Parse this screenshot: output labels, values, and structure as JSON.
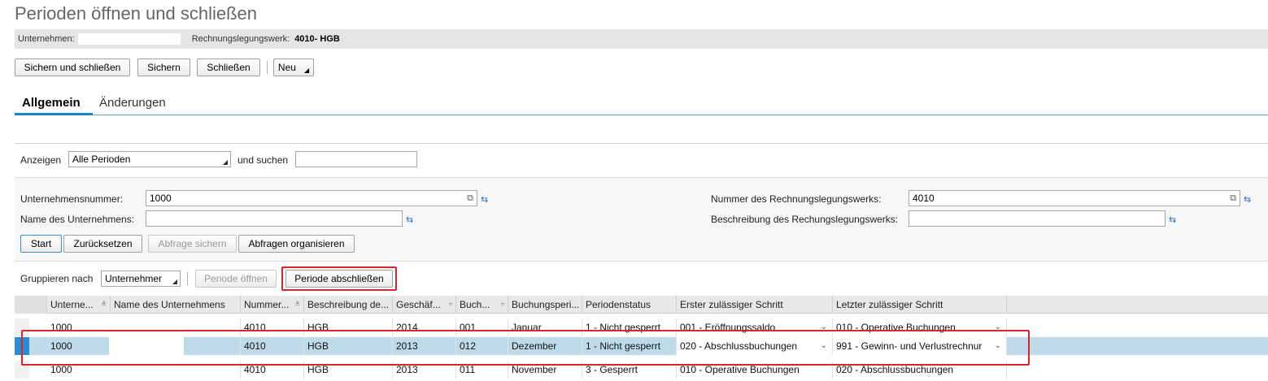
{
  "title": "Perioden öffnen und schließen",
  "header": {
    "company_label": "Unternehmen:",
    "company_value": "",
    "ledger_label": "Rechnungslegungswerk:",
    "ledger_value": "4010- HGB"
  },
  "toolbar": {
    "save_close": "Sichern und schließen",
    "save": "Sichern",
    "close": "Schließen",
    "new": "Neu"
  },
  "tabs": {
    "general": "Allgemein",
    "changes": "Änderungen"
  },
  "show_bar": {
    "show_label": "Anzeigen",
    "show_value": "Alle Perioden",
    "search_label": "und suchen",
    "search_value": ""
  },
  "filter": {
    "company_number_label": "Unternehmensnummer:",
    "company_number_value": "1000",
    "company_name_label": "Name des Unternehmens:",
    "company_name_value": "",
    "ledger_number_label": "Nummer des Rechnungslegungswerks:",
    "ledger_number_value": "4010",
    "ledger_desc_label": "Beschreibung des Rechungslegungswerks:",
    "ledger_desc_value": "",
    "start": "Start",
    "reset": "Zurücksetzen",
    "save_query": "Abfrage sichern",
    "organize_queries": "Abfragen organisieren"
  },
  "action_bar": {
    "group_label": "Gruppieren nach",
    "group_value": "Unternehmer",
    "open_period": "Periode öffnen",
    "close_period": "Periode abschließen"
  },
  "table": {
    "columns": [
      "Unterne...",
      "Name des Unternehmens",
      "Nummer...",
      "Beschreibung de...",
      "Geschäf...",
      "Buch...",
      "Buchungsperi...",
      "Periodenstatus",
      "Erster zulässiger Schritt",
      "Letzter zulässiger Schritt"
    ],
    "rows": [
      [
        "1000",
        "",
        "4010",
        "HGB",
        "2014",
        "001",
        "Januar",
        "1 - Nicht gesperrt",
        "001 - Eröffnungssaldo",
        "010 - Operative Buchungen"
      ],
      [
        "1000",
        "",
        "4010",
        "HGB",
        "2013",
        "012",
        "Dezember",
        "1 - Nicht gesperrt",
        "020 - Abschlussbuchungen",
        "991 - Gewinn- und Verlustrechnur"
      ],
      [
        "1000",
        "",
        "4010",
        "HGB",
        "2013",
        "011",
        "November",
        "3 - Gesperrt",
        "010 - Operative Buchungen",
        "020 - Abschlussbuchungen"
      ]
    ]
  },
  "colors": {
    "accent": "#1a83c6",
    "highlight": "#d9262c",
    "selected_row": "#bfdbea"
  }
}
